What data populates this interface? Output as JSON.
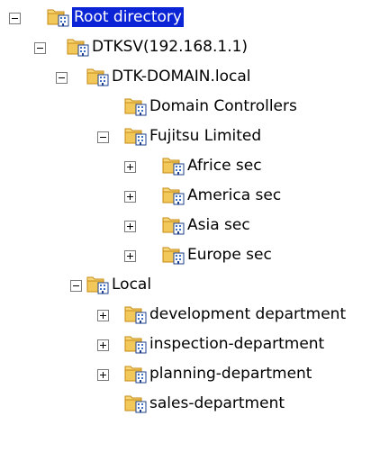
{
  "tree": {
    "root": {
      "label": "Root directory",
      "toggle": "−",
      "selected": true
    },
    "server": {
      "label": "DTKSV(192.168.1.1)",
      "toggle": "−"
    },
    "domain": {
      "label": "DTK-DOMAIN.local",
      "toggle": "−"
    },
    "domain_controllers": {
      "label": "Domain Controllers"
    },
    "fujitsu": {
      "label": "Fujitsu Limited",
      "toggle": "−"
    },
    "africe": {
      "label": "Africe sec",
      "toggle": "+"
    },
    "america": {
      "label": "America sec",
      "toggle": "+"
    },
    "asia": {
      "label": "Asia sec",
      "toggle": "+"
    },
    "europe": {
      "label": "Europe sec",
      "toggle": "+"
    },
    "local": {
      "label": "Local",
      "toggle": "−"
    },
    "development": {
      "label": "development department",
      "toggle": "+"
    },
    "inspection": {
      "label": "inspection-department",
      "toggle": "+"
    },
    "planning": {
      "label": "planning-department",
      "toggle": "+"
    },
    "sales": {
      "label": "sales-department"
    }
  },
  "icons": {
    "folder": "folder-with-directory-icon"
  },
  "colors": {
    "selection": "#0a24d6",
    "folder": "#f3c85a",
    "folder_dark": "#d99a1f",
    "doc_blue": "#3a6fc4"
  }
}
